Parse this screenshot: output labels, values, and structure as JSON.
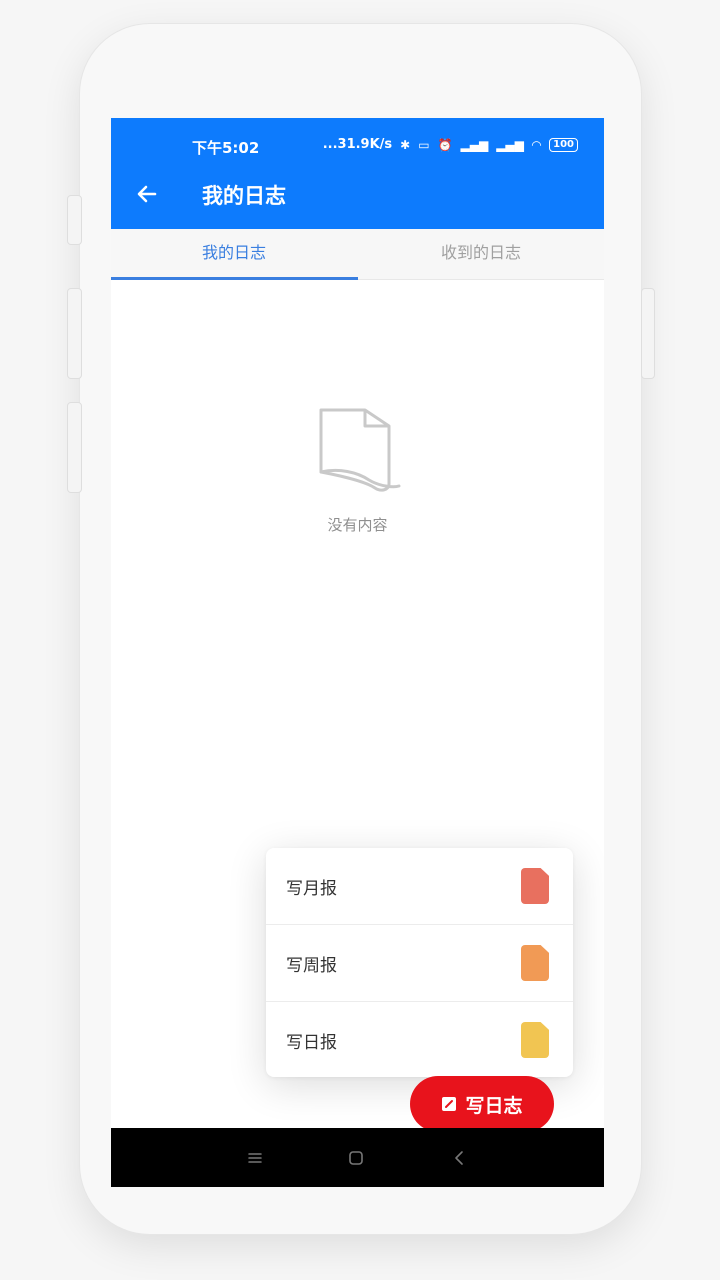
{
  "status_bar": {
    "time": "下午5:02",
    "network_speed": "...31.9K/s",
    "battery": "100"
  },
  "header": {
    "title": "我的日志"
  },
  "tabs": [
    {
      "label": "我的日志",
      "active": true
    },
    {
      "label": "收到的日志",
      "active": false
    }
  ],
  "empty_state": {
    "text": "没有内容"
  },
  "write_menu": {
    "items": [
      {
        "label": "写月报",
        "icon": "document-icon",
        "color": "#e8705f"
      },
      {
        "label": "写周报",
        "icon": "document-icon",
        "color": "#f19a55"
      },
      {
        "label": "写日报",
        "icon": "document-icon",
        "color": "#f1c552"
      }
    ]
  },
  "fab": {
    "label": "写日志",
    "color": "#e8131c"
  },
  "colors": {
    "app_bar": "#0d7bfd",
    "tab_active": "#3a7fe0"
  }
}
